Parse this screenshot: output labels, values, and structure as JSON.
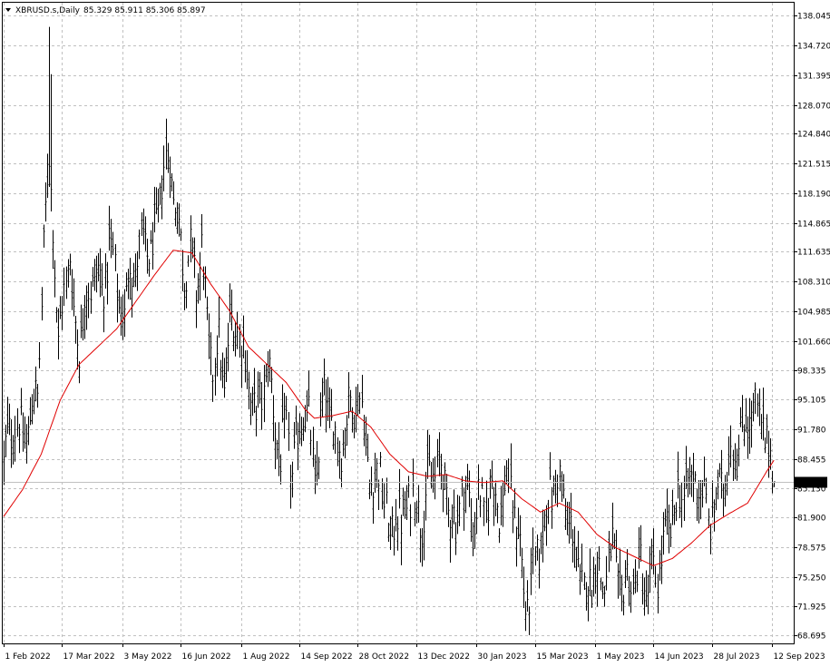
{
  "header": {
    "symbol": "XBRUSD.s,Daily",
    "ohlc": "85.329 85.911 85.306 85.897"
  },
  "price_label": "85.897",
  "colors": {
    "background": "#ffffff",
    "bars": "#000000",
    "ma_line": "#e00000",
    "grid": "#c0c0c0",
    "price_line": "#c0c0c0",
    "price_label_bg": "#000000",
    "price_label_fg": "#ffffff"
  },
  "chart_data": {
    "type": "bar",
    "title": "",
    "series_name": "",
    "y_ticks": [
      138.045,
      134.72,
      131.395,
      128.07,
      124.84,
      121.515,
      118.19,
      114.865,
      111.635,
      108.31,
      104.985,
      101.66,
      98.335,
      95.105,
      91.78,
      88.455,
      85.13,
      81.9,
      78.575,
      75.25,
      71.925,
      68.695
    ],
    "y_tick_labels": [
      "138.045",
      "134.720",
      "131.395",
      "128.070",
      "124.840",
      "121.515",
      "118.190",
      "114.865",
      "111.635",
      "108.310",
      "104.985",
      "101.660",
      "98.335",
      "95.105",
      "91.780",
      "88.455",
      "85.130",
      "81.900",
      "78.575",
      "75.250",
      "71.925",
      "68.695"
    ],
    "ylim": [
      67.8,
      139.5
    ],
    "x_tick_labels": [
      "1 Feb 2022",
      "17 Mar 2022",
      "3 May 2022",
      "16 Jun 2022",
      "1 Aug 2022",
      "14 Sep 2022",
      "28 Oct 2022",
      "13 Dec 2022",
      "30 Jan 2023",
      "15 Mar 2023",
      "1 May 2023",
      "14 Jun 2023",
      "28 Jul 2023",
      "12 Sep 2023"
    ],
    "x_tick_index": [
      0,
      31,
      63,
      94,
      126,
      157,
      188,
      219,
      251,
      282,
      314,
      345,
      376,
      408
    ],
    "bar_count": 420,
    "last_close": 85.897,
    "price_key": [
      [
        0,
        88
      ],
      [
        3,
        91
      ],
      [
        6,
        93
      ],
      [
        10,
        90
      ],
      [
        14,
        93
      ],
      [
        18,
        96
      ],
      [
        21,
        112
      ],
      [
        24,
        122
      ],
      [
        26,
        116
      ],
      [
        29,
        100
      ],
      [
        32,
        108
      ],
      [
        35,
        111
      ],
      [
        37,
        104
      ],
      [
        40,
        102
      ],
      [
        44,
        106
      ],
      [
        48,
        110
      ],
      [
        52,
        107
      ],
      [
        56,
        112
      ],
      [
        60,
        108
      ],
      [
        64,
        103
      ],
      [
        67,
        112
      ],
      [
        70,
        108
      ],
      [
        74,
        114
      ],
      [
        78,
        110
      ],
      [
        82,
        117
      ],
      [
        86,
        121
      ],
      [
        88,
        123
      ],
      [
        90,
        118
      ],
      [
        93,
        114
      ],
      [
        96,
        110
      ],
      [
        99,
        111
      ],
      [
        102,
        108
      ],
      [
        105,
        112
      ],
      [
        108,
        103
      ],
      [
        111,
        99
      ],
      [
        114,
        101
      ],
      [
        117,
        97
      ],
      [
        120,
        103
      ],
      [
        124,
        104
      ],
      [
        128,
        99
      ],
      [
        131,
        96
      ],
      [
        134,
        93
      ],
      [
        137,
        96
      ],
      [
        140,
        99
      ],
      [
        143,
        94
      ],
      [
        147,
        88
      ],
      [
        150,
        92
      ],
      [
        153,
        87
      ],
      [
        156,
        90
      ],
      [
        159,
        95
      ],
      [
        162,
        92
      ],
      [
        165,
        86
      ],
      [
        168,
        92
      ],
      [
        171,
        96
      ],
      [
        174,
        93
      ],
      [
        177,
        89
      ],
      [
        180,
        91
      ],
      [
        184,
        94
      ],
      [
        188,
        96
      ],
      [
        191,
        92
      ],
      [
        194,
        87
      ],
      [
        197,
        85
      ],
      [
        200,
        88
      ],
      [
        203,
        82
      ],
      [
        205,
        78
      ],
      [
        208,
        84
      ],
      [
        211,
        80
      ],
      [
        215,
        85
      ],
      [
        219,
        83
      ],
      [
        222,
        82
      ],
      [
        226,
        86
      ],
      [
        230,
        88
      ],
      [
        233,
        86
      ],
      [
        237,
        83
      ],
      [
        240,
        80
      ],
      [
        243,
        86
      ],
      [
        246,
        84
      ],
      [
        249,
        81
      ],
      [
        252,
        84
      ],
      [
        255,
        82
      ],
      [
        258,
        86
      ],
      [
        261,
        84
      ],
      [
        264,
        83
      ],
      [
        267,
        86
      ],
      [
        270,
        84
      ],
      [
        273,
        80
      ],
      [
        276,
        74
      ],
      [
        278,
        72
      ],
      [
        281,
        75
      ],
      [
        284,
        79
      ],
      [
        287,
        81
      ],
      [
        290,
        85
      ],
      [
        293,
        86
      ],
      [
        296,
        85
      ],
      [
        299,
        82
      ],
      [
        302,
        79
      ],
      [
        305,
        77
      ],
      [
        308,
        73
      ],
      [
        311,
        75
      ],
      [
        314,
        77
      ],
      [
        317,
        74
      ],
      [
        320,
        76
      ],
      [
        323,
        78
      ],
      [
        326,
        75
      ],
      [
        329,
        73
      ],
      [
        332,
        76
      ],
      [
        335,
        74
      ],
      [
        338,
        77
      ],
      [
        341,
        73
      ],
      [
        344,
        75
      ],
      [
        347,
        76
      ],
      [
        350,
        78
      ],
      [
        353,
        81
      ],
      [
        356,
        83
      ],
      [
        359,
        84
      ],
      [
        362,
        86
      ],
      [
        365,
        85
      ],
      [
        368,
        87
      ],
      [
        371,
        84
      ],
      [
        374,
        82
      ],
      [
        377,
        83
      ],
      [
        380,
        85
      ],
      [
        383,
        87
      ],
      [
        386,
        89
      ],
      [
        389,
        90
      ],
      [
        392,
        91
      ],
      [
        395,
        93
      ],
      [
        398,
        94
      ],
      [
        401,
        92
      ],
      [
        403,
        93
      ],
      [
        405,
        90
      ],
      [
        407,
        88
      ],
      [
        409,
        85.9
      ]
    ],
    "ma_key": [
      [
        0,
        82
      ],
      [
        10,
        85
      ],
      [
        20,
        89
      ],
      [
        30,
        95
      ],
      [
        40,
        99
      ],
      [
        50,
        101
      ],
      [
        60,
        103
      ],
      [
        70,
        106
      ],
      [
        80,
        109
      ],
      [
        90,
        111.8
      ],
      [
        100,
        111.5
      ],
      [
        110,
        108
      ],
      [
        120,
        105
      ],
      [
        130,
        101
      ],
      [
        140,
        99
      ],
      [
        150,
        97
      ],
      [
        160,
        94
      ],
      [
        165,
        93
      ],
      [
        175,
        93.3
      ],
      [
        185,
        93.8
      ],
      [
        195,
        92
      ],
      [
        205,
        89
      ],
      [
        215,
        87
      ],
      [
        225,
        86.5
      ],
      [
        235,
        86.7
      ],
      [
        245,
        86
      ],
      [
        255,
        85.8
      ],
      [
        265,
        86
      ],
      [
        275,
        84
      ],
      [
        285,
        82.5
      ],
      [
        295,
        83.5
      ],
      [
        305,
        82.5
      ],
      [
        315,
        80
      ],
      [
        325,
        78.5
      ],
      [
        335,
        77.5
      ],
      [
        345,
        76.5
      ],
      [
        355,
        77.3
      ],
      [
        365,
        79
      ],
      [
        375,
        81
      ],
      [
        385,
        82.3
      ],
      [
        395,
        83.5
      ],
      [
        405,
        87
      ],
      [
        409,
        88.3
      ]
    ]
  }
}
